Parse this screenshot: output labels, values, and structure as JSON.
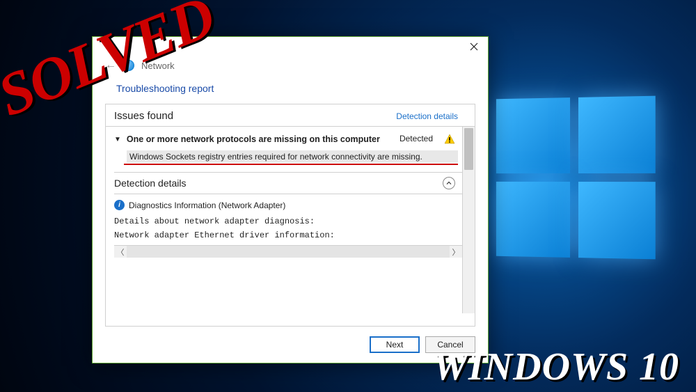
{
  "overlay": {
    "solved": "SOLVED",
    "win10": "WINDOWS 10"
  },
  "dialog": {
    "header_category": "Network",
    "report_title": "Troubleshooting report",
    "issues_heading": "Issues found",
    "detection_link": "Detection details",
    "issue": {
      "title": "One or more network protocols are missing on this computer",
      "status": "Detected",
      "description": "Windows Sockets registry entries required for network connectivity are missing."
    },
    "detection_section": "Detection details",
    "diag_label": "Diagnostics Information (Network Adapter)",
    "mono1": "Details about network adapter diagnosis:",
    "mono2": "Network adapter Ethernet driver information:",
    "buttons": {
      "next": "Next",
      "cancel": "Cancel"
    }
  }
}
